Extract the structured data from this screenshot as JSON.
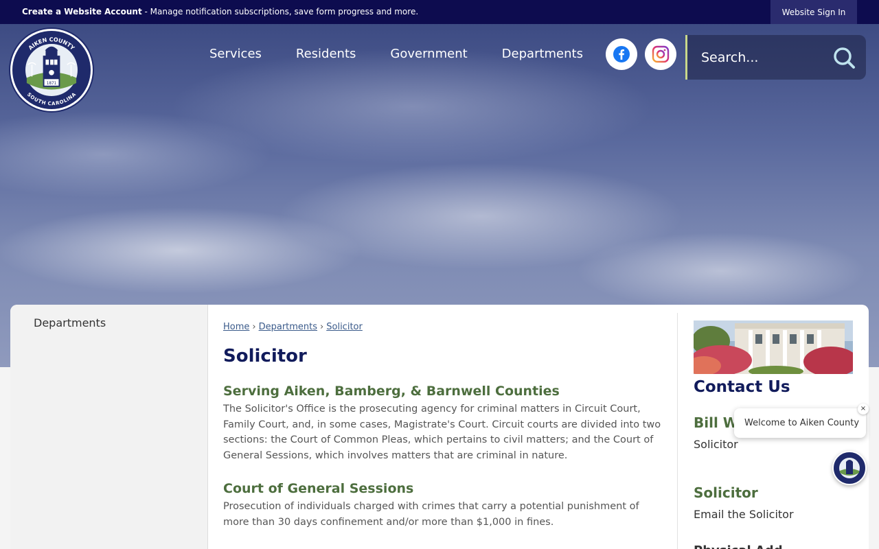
{
  "topbar": {
    "account_strong": "Create a Website Account",
    "account_rest": " - Manage notification subscriptions, save form progress and more.",
    "signin": "Website Sign In"
  },
  "logo": {
    "top_text": "AIKEN COUNTY",
    "bottom_text": "SOUTH CAROLINA",
    "year": "1871"
  },
  "nav": {
    "items": [
      "Services",
      "Residents",
      "Government",
      "Departments"
    ]
  },
  "search": {
    "placeholder": "Search..."
  },
  "sidebar": {
    "link": "Departments"
  },
  "breadcrumb": {
    "home": "Home",
    "departments": "Departments",
    "current": "Solicitor"
  },
  "main": {
    "title": "Solicitor",
    "sections": [
      {
        "heading": "Serving Aiken, Bamberg, & Barnwell Counties",
        "text": "The Solicitor's Office is the prosecuting agency for criminal matters in Circuit Court, Family Court, and, in some cases, Magistrate's Court. Circuit courts are divided into two sections: the Court of Common Pleas, which pertains to civil matters; and the Court of General Sessions, which involves matters that are criminal in nature."
      },
      {
        "heading": "Court of General Sessions",
        "text": "Prosecution of individuals charged with crimes that carry a potential punishment of more than 30 days confinement and/or more than $1,000 in fines."
      }
    ]
  },
  "contact": {
    "title": "Contact Us",
    "name": "Bill W",
    "role": "Solicitor",
    "dept": "Solicitor",
    "email": "Email the Solicitor",
    "physical": "Physical Add"
  },
  "chat": {
    "welcome": "Welcome to Aiken County",
    "close": "×"
  },
  "colors": {
    "navy": "#0d0c4f",
    "title_blue": "#111b5b",
    "heading_green": "#4d6e3e"
  }
}
